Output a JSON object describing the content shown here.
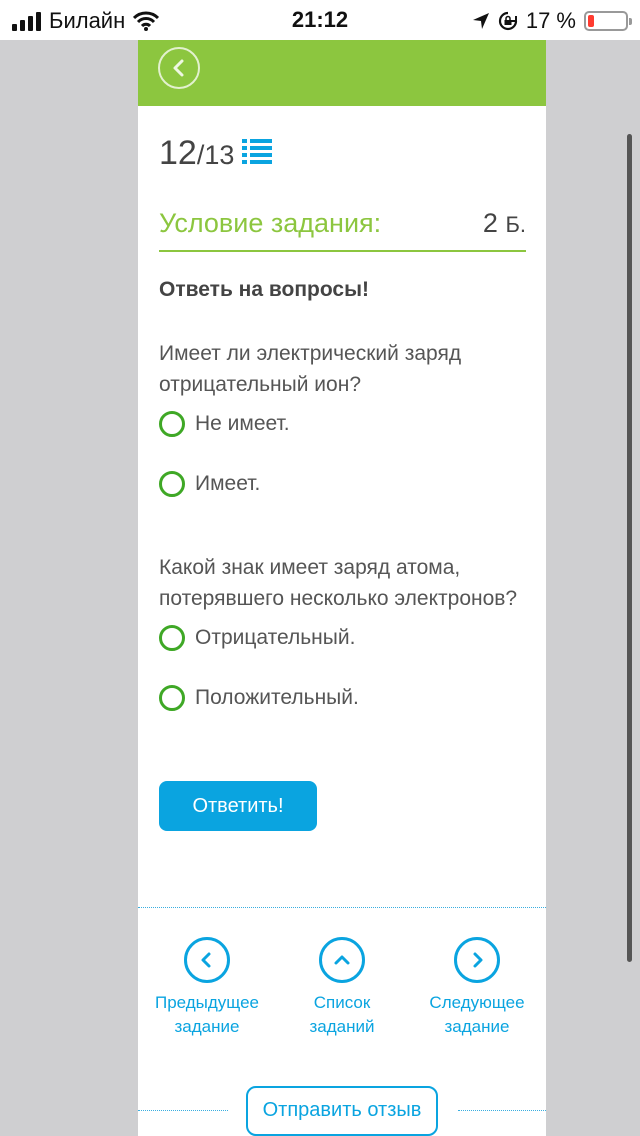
{
  "status_bar": {
    "carrier": "Билайн",
    "time": "21:12",
    "battery_percent": "17 %"
  },
  "task": {
    "current": "12",
    "total": "/13"
  },
  "condition": {
    "title": "Условие задания:",
    "score_value": "2",
    "score_unit": "Б."
  },
  "instruction": "Ответь на вопросы!",
  "questions": [
    {
      "text": "Имеет ли электрический заряд отрицательный ион?",
      "options": [
        "Не имеет.",
        "Имеет."
      ]
    },
    {
      "text": "Какой знак имеет заряд атома, потерявшего несколько электронов?",
      "options": [
        "Отрицательный.",
        "Положительный."
      ]
    }
  ],
  "answer_button": "Ответить!",
  "nav": {
    "prev": [
      "Предыдущее",
      "задание"
    ],
    "list": [
      "Список",
      "заданий"
    ],
    "next": [
      "Следующее",
      "задание"
    ]
  },
  "feedback_button": "Отправить отзыв",
  "colors": {
    "header_green": "#8cc63f",
    "radio_green": "#3fa826",
    "accent_blue": "#0aa4e0",
    "battery_red": "#ff3b30"
  },
  "icons": [
    "cellular-signal-icon",
    "wifi-icon",
    "location-arrow-icon",
    "orientation-lock-icon",
    "battery-icon",
    "back-arrow-icon",
    "task-list-icon",
    "chevron-left-icon",
    "chevron-up-icon",
    "chevron-right-icon"
  ]
}
